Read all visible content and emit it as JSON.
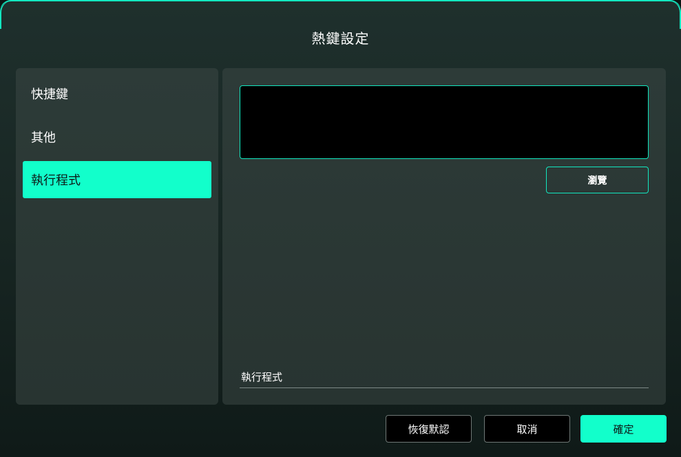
{
  "dialog": {
    "title": "熱鍵設定"
  },
  "sidebar": {
    "items": [
      {
        "label": "快捷鍵"
      },
      {
        "label": "其他"
      },
      {
        "label": "執行程式",
        "active": true
      }
    ]
  },
  "content": {
    "path_value": "",
    "browse_label": "瀏覽",
    "program_label": "執行程式"
  },
  "footer": {
    "restore_label": "恢復默認",
    "cancel_label": "取消",
    "confirm_label": "確定"
  },
  "colors": {
    "accent": "#12ffcb",
    "border_accent": "#12e8c0",
    "panel": "#2d3b38",
    "background": "#172522"
  }
}
